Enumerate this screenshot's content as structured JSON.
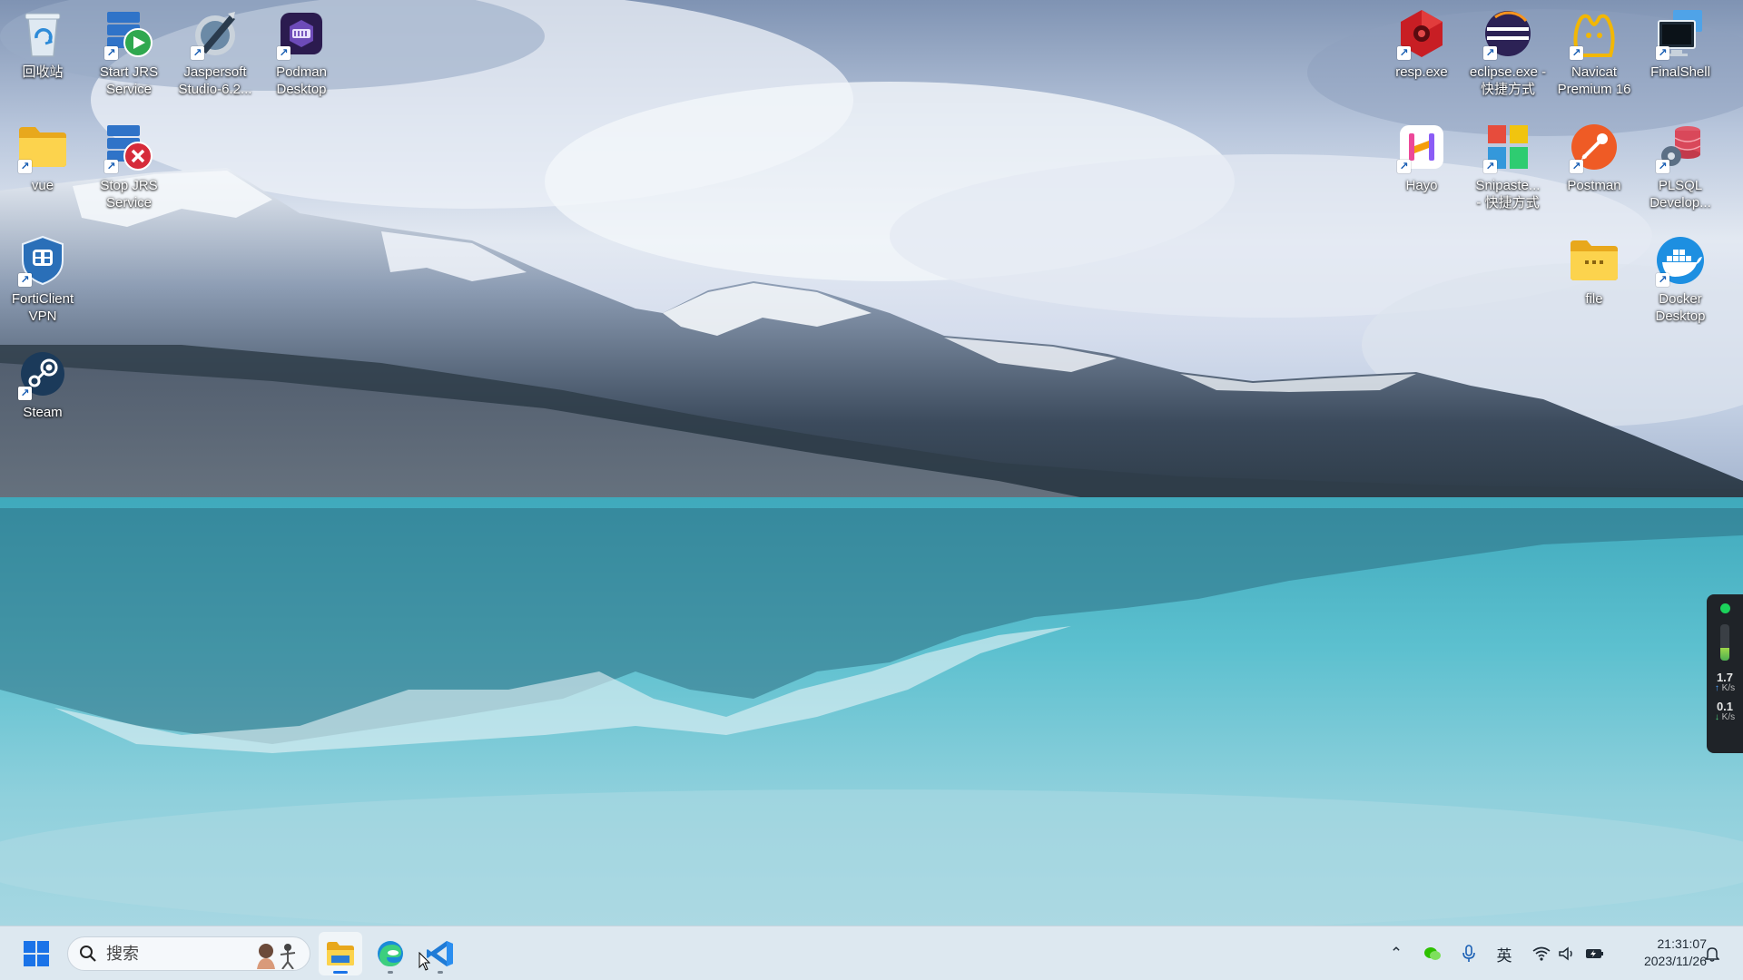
{
  "desktop": {
    "icons": [
      {
        "id": "recycle-bin",
        "label": "回收站",
        "shortcut": false
      },
      {
        "id": "start-jrs",
        "label": "Start JRS\nService",
        "shortcut": true
      },
      {
        "id": "jaspersoft",
        "label": "Jaspersoft\nStudio-6.2...",
        "shortcut": true
      },
      {
        "id": "podman",
        "label": "Podman\nDesktop",
        "shortcut": true
      },
      {
        "id": "vue",
        "label": "vue",
        "shortcut": true
      },
      {
        "id": "stop-jrs",
        "label": "Stop JRS\nService",
        "shortcut": true
      },
      {
        "id": "forticlient",
        "label": "FortiClient\nVPN",
        "shortcut": true
      },
      {
        "id": "steam",
        "label": "Steam",
        "shortcut": true
      },
      {
        "id": "resp",
        "label": "resp.exe",
        "shortcut": true
      },
      {
        "id": "eclipse",
        "label": "eclipse.exe -\n快捷方式",
        "shortcut": true
      },
      {
        "id": "navicat",
        "label": "Navicat\nPremium 16",
        "shortcut": true
      },
      {
        "id": "finalshell",
        "label": "FinalShell",
        "shortcut": true
      },
      {
        "id": "hayo",
        "label": "Hayo",
        "shortcut": true
      },
      {
        "id": "snipaste",
        "label": "Snipaste...\n- 快捷方式",
        "shortcut": true
      },
      {
        "id": "postman",
        "label": "Postman",
        "shortcut": true
      },
      {
        "id": "plsql",
        "label": "PLSQL\nDevelop...",
        "shortcut": true
      },
      {
        "id": "file",
        "label": "file",
        "shortcut": false
      },
      {
        "id": "docker",
        "label": "Docker\nDesktop",
        "shortcut": true
      }
    ]
  },
  "taskbar": {
    "search_placeholder": "搜索",
    "apps": [
      {
        "id": "file-explorer",
        "active": true
      },
      {
        "id": "edge",
        "active": false
      },
      {
        "id": "vscode",
        "active": false
      }
    ],
    "tray": {
      "ime_label": "英",
      "time": "21:31:07",
      "date": "2023/11/26"
    }
  },
  "net_widget": {
    "upload_value": "1.7",
    "upload_unit": "K/s",
    "download_value": "0.1",
    "download_unit": "K/s",
    "level": 0.35
  }
}
